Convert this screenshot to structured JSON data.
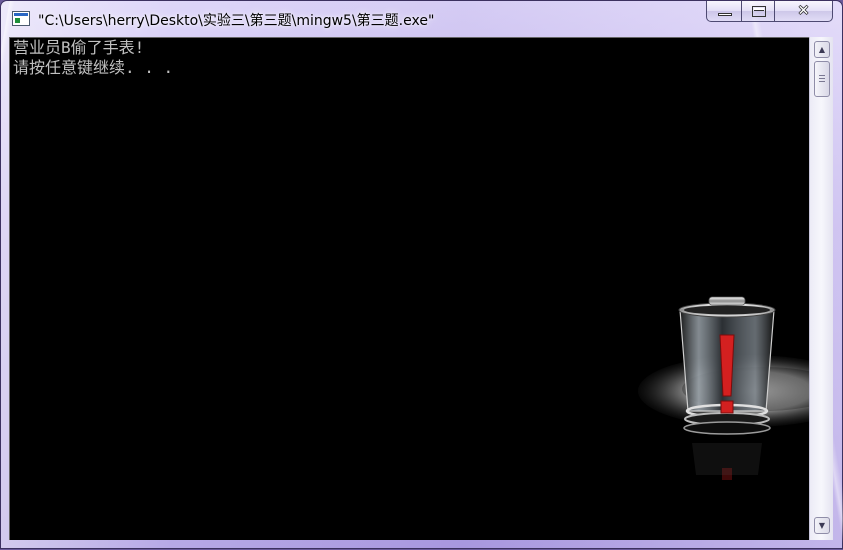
{
  "window": {
    "title": "\"C:\\Users\\herry\\Deskto\\实验三\\第三题\\mingw5\\第三题.exe\"",
    "controls": {
      "minimize_icon": "minimize-icon",
      "maximize_icon": "maximize-icon",
      "close_glyph": "✕"
    }
  },
  "console": {
    "lines": [
      "营业员B偷了手表!",
      "请按任意键继续. . ."
    ],
    "text_color": "#c0c0c0",
    "background_color": "#000000"
  },
  "scrollbar": {
    "up_glyph": "▲",
    "down_glyph": "▼"
  },
  "desktop": {
    "icon": "recycle-bin-icon",
    "exclamation_color": "#d42020"
  }
}
